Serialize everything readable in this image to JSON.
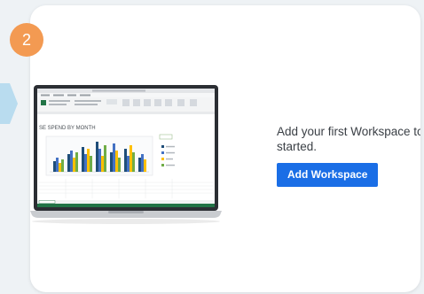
{
  "step": {
    "number": "2"
  },
  "onboarding": {
    "message": "Add your first Workspace to get started.",
    "add_workspace_label": "Add Workspace"
  },
  "illustration": {
    "icon": "laptop-spreadsheet-icon",
    "sheet_title": "SE SPEND BY MONTH"
  },
  "colors": {
    "step_badge": "#f39a52",
    "primary_button": "#1a6ee6",
    "connector": "#b9dcef",
    "spreadsheet_ribbon": "#217346"
  }
}
